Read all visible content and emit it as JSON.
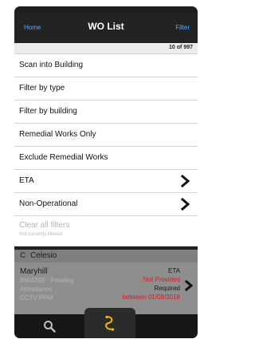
{
  "navbar": {
    "left": "Home",
    "title": "WO List",
    "right": "Filter"
  },
  "count": "10 of 997",
  "menu": [
    {
      "label": "Scan into Building"
    },
    {
      "label": "Filter by type"
    },
    {
      "label": "Filter by building"
    },
    {
      "label": "Remedial Works Only"
    },
    {
      "label": "Exclude Remedial Works"
    },
    {
      "label": "ETA"
    },
    {
      "label": "Non-Operational"
    }
  ],
  "clear": {
    "title": "Clear all filters",
    "subtitle": "Not currently filtered"
  },
  "list": {
    "group_letter": "C",
    "group_name": "Celesio",
    "row": {
      "title": "Maryhill",
      "line1": "8964399 - Pending",
      "line2": "Attendance",
      "line3": "CCTV PPM",
      "eta_label": "ETA",
      "eta_status": "Not Provided",
      "eta_required": "Required",
      "eta_window": "between 01/08/2018"
    }
  },
  "tabs": {
    "search": "search-icon",
    "route": "route-icon"
  },
  "colors": {
    "link_blue": "#5aa8ff",
    "alert_red": "#d41f1f",
    "navbar": "#232323"
  }
}
